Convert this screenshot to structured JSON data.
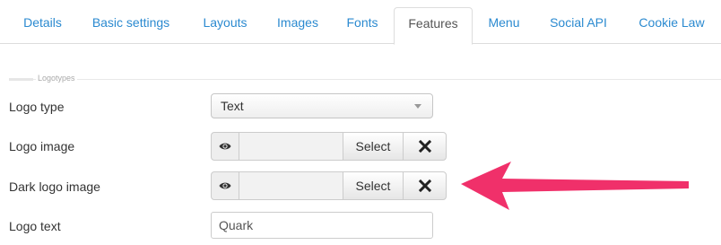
{
  "tabs": [
    {
      "label": "Details",
      "active": false
    },
    {
      "label": "Basic settings",
      "active": false
    },
    {
      "label": "Layouts",
      "active": false
    },
    {
      "label": "Images",
      "active": false
    },
    {
      "label": "Fonts",
      "active": false
    },
    {
      "label": "Features",
      "active": true
    },
    {
      "label": "Menu",
      "active": false
    },
    {
      "label": "Social API",
      "active": false
    },
    {
      "label": "Cookie Law",
      "active": false
    }
  ],
  "fieldset": {
    "legend": "Logotypes"
  },
  "form": {
    "logo_type": {
      "label": "Logo type",
      "value": "Text"
    },
    "logo_image": {
      "label": "Logo image",
      "select_label": "Select",
      "preview_icon": "eye-icon",
      "clear_icon": "close-icon"
    },
    "dark_logo_image": {
      "label": "Dark logo image",
      "select_label": "Select",
      "preview_icon": "eye-icon",
      "clear_icon": "close-icon"
    },
    "logo_text": {
      "label": "Logo text",
      "value": "Quark"
    }
  },
  "annotation": {
    "arrow_color": "#f0306a"
  },
  "colors": {
    "link": "#2b8ad0",
    "border": "#dddddd"
  }
}
